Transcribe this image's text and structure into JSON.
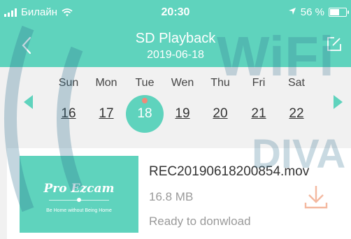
{
  "status_bar": {
    "carrier": "Билайн",
    "time": "20:30",
    "battery_percent": "56 %",
    "battery_level": 0.56
  },
  "nav": {
    "title": "SD Playback",
    "subtitle": "2019-06-18"
  },
  "calendar": {
    "days": [
      {
        "name": "Sun",
        "num": "16"
      },
      {
        "name": "Mon",
        "num": "17"
      },
      {
        "name": "Tue",
        "num": "18",
        "selected": true
      },
      {
        "name": "Wen",
        "num": "19"
      },
      {
        "name": "Thu",
        "num": "20"
      },
      {
        "name": "Fri",
        "num": "21"
      },
      {
        "name": "Sat",
        "num": "22"
      }
    ]
  },
  "recordings": [
    {
      "thumb_logo": "Pro Ezcam",
      "thumb_tagline": "Be Home without Being Home",
      "file_name": "REC20190618200854.mov",
      "file_size": "16.8 MB",
      "status": "Ready to donwload"
    }
  ],
  "watermark": {
    "line1": "WiFi",
    "line2": "DIVA"
  },
  "colors": {
    "accent": "#5fd3bd",
    "event_dot": "#f08a7a",
    "download_icon": "#f4b9a0",
    "watermark": "#2d6f8e"
  },
  "icons": {
    "back": "chevron-left-icon",
    "edit": "edit-icon",
    "download": "download-icon",
    "wifi": "wifi-icon",
    "location": "location-arrow-icon"
  }
}
